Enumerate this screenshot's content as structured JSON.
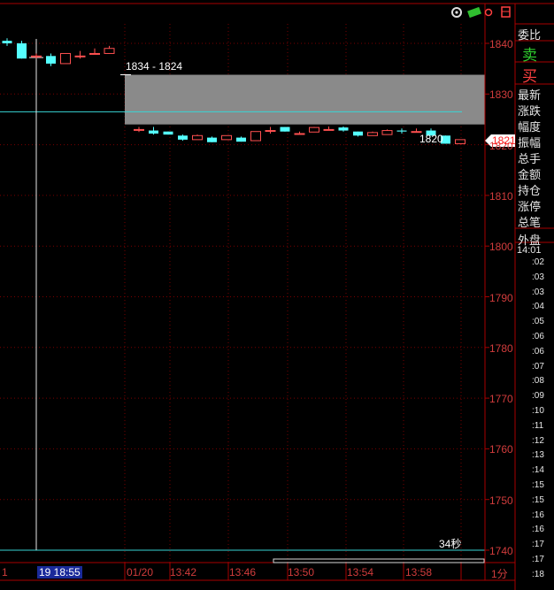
{
  "colors": {
    "grid": "#7a0000",
    "axis": "#a80000",
    "up": "#ff5050",
    "down": "#5ff",
    "zone": "#8a8a8a",
    "crosshair": "#e8e8e8",
    "cyan_line": "#38d6d6",
    "price_tag_bg": "#ffffff",
    "price_tag_fg": "#ff2020"
  },
  "chart": {
    "price_axis": {
      "min": 1740,
      "max": 1840,
      "ticks": [
        "1840",
        "1830",
        "1820",
        "1810",
        "1800",
        "1790",
        "1780",
        "1770",
        "1760",
        "1750",
        "1740"
      ]
    },
    "time_axis": {
      "labels": [
        "1",
        "19 18:55",
        "01/20",
        "13:42",
        "13:46",
        "13:50",
        "13:54",
        "13:58",
        "1分"
      ]
    },
    "zone_label": "1834 - 1824",
    "cursor_price_label": "1820",
    "current_price_tag": "1821",
    "countdown": "34秒",
    "candles": [
      {
        "o": 1840.5,
        "h": 1841,
        "l": 1839.5,
        "c": 1840
      },
      {
        "o": 1840,
        "h": 1840.5,
        "l": 1837,
        "c": 1837
      },
      {
        "o": 1837.5,
        "h": 1838,
        "l": 1837,
        "c": 1837.5
      },
      {
        "o": 1837.5,
        "h": 1838,
        "l": 1835.5,
        "c": 1836
      },
      {
        "o": 1836,
        "h": 1838,
        "l": 1836,
        "c": 1838
      },
      {
        "o": 1837.5,
        "h": 1838.5,
        "l": 1837,
        "c": 1837.5
      },
      {
        "o": 1838,
        "h": 1839,
        "l": 1838,
        "c": 1838
      },
      {
        "o": 1838,
        "h": 1839.5,
        "l": 1838,
        "c": 1839
      }
    ],
    "candles2": [
      {
        "o": 1823,
        "h": 1823.5,
        "l": 1822.5,
        "c": 1823
      },
      {
        "o": 1822.8,
        "h": 1823.5,
        "l": 1822,
        "c": 1822.2
      },
      {
        "o": 1822.6,
        "h": 1822.6,
        "l": 1822,
        "c": 1822
      },
      {
        "o": 1821.8,
        "h": 1822,
        "l": 1820.8,
        "c": 1821
      },
      {
        "o": 1821,
        "h": 1822,
        "l": 1821,
        "c": 1821.8
      },
      {
        "o": 1821.4,
        "h": 1821.6,
        "l": 1820.5,
        "c": 1820.5
      },
      {
        "o": 1821,
        "h": 1821.8,
        "l": 1821,
        "c": 1821.8
      },
      {
        "o": 1821.4,
        "h": 1821.6,
        "l": 1820.6,
        "c": 1820.6
      },
      {
        "o": 1820.8,
        "h": 1822.6,
        "l": 1820.8,
        "c": 1822.6
      },
      {
        "o": 1822.8,
        "h": 1823.5,
        "l": 1822.2,
        "c": 1822.8
      },
      {
        "o": 1823.5,
        "h": 1823.5,
        "l": 1822.6,
        "c": 1822.6
      },
      {
        "o": 1822.2,
        "h": 1822.6,
        "l": 1822,
        "c": 1822.2
      },
      {
        "o": 1822.5,
        "h": 1823.5,
        "l": 1822.5,
        "c": 1823.4
      },
      {
        "o": 1823,
        "h": 1823.6,
        "l": 1823,
        "c": 1823
      },
      {
        "o": 1823.4,
        "h": 1823.6,
        "l": 1822.6,
        "c": 1822.8
      },
      {
        "o": 1822.6,
        "h": 1822.6,
        "l": 1821.6,
        "c": 1821.8
      },
      {
        "o": 1821.8,
        "h": 1822.6,
        "l": 1821.8,
        "c": 1822.4
      },
      {
        "o": 1822,
        "h": 1823,
        "l": 1822,
        "c": 1822.8
      },
      {
        "o": 1822.8,
        "h": 1823.2,
        "l": 1822.2,
        "c": 1822.6
      },
      {
        "o": 1822.6,
        "h": 1823.2,
        "l": 1822.4,
        "c": 1822.6
      },
      {
        "o": 1822.8,
        "h": 1823.2,
        "l": 1821.8,
        "c": 1821.8
      },
      {
        "o": 1821.8,
        "h": 1821.8,
        "l": 1820.2,
        "c": 1820.2
      },
      {
        "o": 1820.2,
        "h": 1821,
        "l": 1820.2,
        "c": 1821
      }
    ]
  },
  "right_panel": {
    "labels": {
      "weibi": "委比",
      "sell": "卖",
      "buy": "买",
      "latest": "最新",
      "change": "涨跌",
      "pct": "幅度",
      "amplitude": "振幅",
      "volume": "总手",
      "amount": "金额",
      "open_interest": "持仓",
      "limit_up": "涨停",
      "trades": "总笔",
      "outer": "外盘"
    },
    "time_header": "14:01",
    "ticks": [
      ":02",
      ":03",
      ":03",
      ":04",
      ":05",
      ":06",
      ":06",
      ":07",
      ":08",
      ":09",
      ":10",
      ":11",
      ":12",
      ":13",
      ":14",
      ":15",
      ":15",
      ":16",
      ":16",
      ":17",
      ":17",
      ":18"
    ]
  }
}
